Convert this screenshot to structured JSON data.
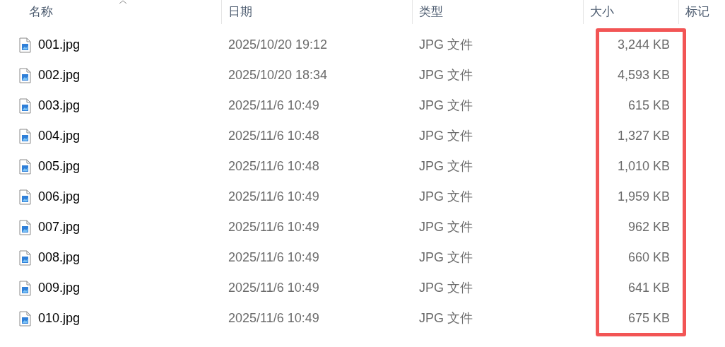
{
  "columns": [
    {
      "label": "名称",
      "sorted": true
    },
    {
      "label": "日期",
      "sorted": false
    },
    {
      "label": "类型",
      "sorted": false
    },
    {
      "label": "大小",
      "sorted": false
    },
    {
      "label": "标记",
      "sorted": false
    }
  ],
  "size_highlight": {
    "on": true,
    "color": "#f25555"
  },
  "rows": [
    {
      "name": "001.jpg",
      "date": "2025/10/20 19:12",
      "type": "JPG 文件",
      "size": "3,244 KB"
    },
    {
      "name": "002.jpg",
      "date": "2025/10/20 18:34",
      "type": "JPG 文件",
      "size": "4,593 KB"
    },
    {
      "name": "003.jpg",
      "date": "2025/11/6 10:49",
      "type": "JPG 文件",
      "size": "615 KB"
    },
    {
      "name": "004.jpg",
      "date": "2025/11/6 10:48",
      "type": "JPG 文件",
      "size": "1,327 KB"
    },
    {
      "name": "005.jpg",
      "date": "2025/11/6 10:48",
      "type": "JPG 文件",
      "size": "1,010 KB"
    },
    {
      "name": "006.jpg",
      "date": "2025/11/6 10:49",
      "type": "JPG 文件",
      "size": "1,959 KB"
    },
    {
      "name": "007.jpg",
      "date": "2025/11/6 10:49",
      "type": "JPG 文件",
      "size": "962 KB"
    },
    {
      "name": "008.jpg",
      "date": "2025/11/6 10:49",
      "type": "JPG 文件",
      "size": "660 KB"
    },
    {
      "name": "009.jpg",
      "date": "2025/11/6 10:49",
      "type": "JPG 文件",
      "size": "641 KB"
    },
    {
      "name": "010.jpg",
      "date": "2025/11/6 10:49",
      "type": "JPG 文件",
      "size": "675 KB"
    }
  ]
}
